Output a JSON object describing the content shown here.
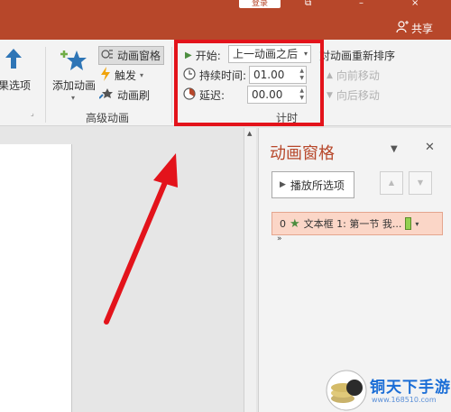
{
  "titlebar": {
    "login_label": "登录",
    "share_label": "共享"
  },
  "ribbon": {
    "effect_options_label": "效果选项",
    "add_animation_label": "添加动画",
    "animation_pane_label": "动画窗格",
    "trigger_label": "触发",
    "animation_painter_label": "动画刷",
    "advanced_group_label": "高级动画",
    "start_label": "开始:",
    "start_value": "上一动画之后",
    "duration_label": "持续时间:",
    "duration_value": "01.00",
    "delay_label": "延迟:",
    "delay_value": "00.00",
    "timing_group_label": "计时",
    "reorder_label": "对动画重新排序",
    "move_earlier_label": "向前移动",
    "move_later_label": "向后移动"
  },
  "pane": {
    "title": "动画窗格",
    "play_label": "播放所选项",
    "item": {
      "index": "0",
      "text": "文本框 1: 第一节 我..."
    }
  },
  "watermark": {
    "text": "铜天下手游",
    "url": "www.168510.com"
  },
  "colors": {
    "accent": "#b7472a",
    "highlight": "#e3131b",
    "watermark": "#1a6dd6"
  }
}
